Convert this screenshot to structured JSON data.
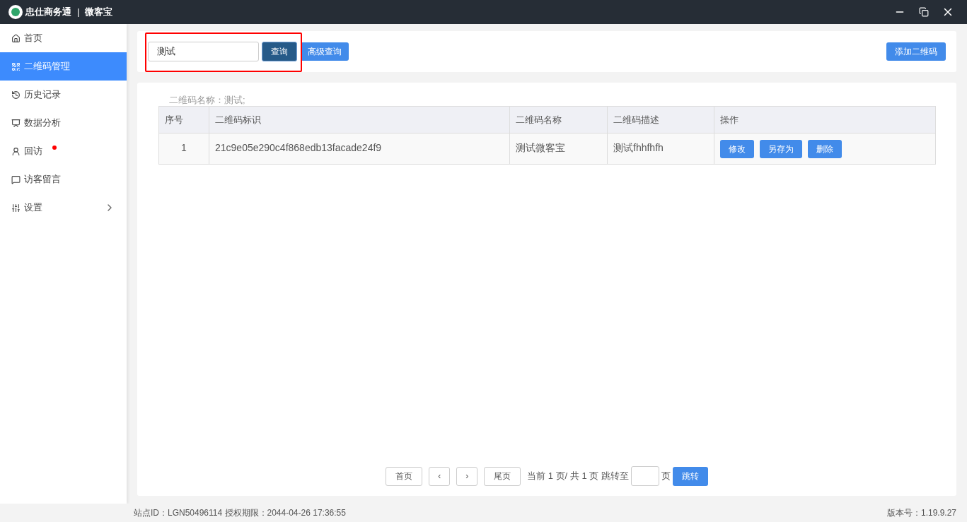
{
  "window": {
    "brand": "忠仕商务通",
    "product": "微客宝",
    "separator": "|"
  },
  "sidebar": {
    "items": [
      {
        "label": "首页",
        "selected": false,
        "badge": false,
        "expandable": false
      },
      {
        "label": "二维码管理",
        "selected": true,
        "badge": false,
        "expandable": false
      },
      {
        "label": "历史记录",
        "selected": false,
        "badge": false,
        "expandable": false
      },
      {
        "label": "数据分析",
        "selected": false,
        "badge": false,
        "expandable": false
      },
      {
        "label": "回访",
        "selected": false,
        "badge": true,
        "expandable": false
      },
      {
        "label": "访客留言",
        "selected": false,
        "badge": false,
        "expandable": false
      },
      {
        "label": "设置",
        "selected": false,
        "badge": false,
        "expandable": true
      }
    ]
  },
  "search": {
    "value": "测试",
    "search_button": "查询",
    "advanced_button": "高级查询",
    "highlighted": true
  },
  "add_button": "添加二维码",
  "filter_summary": "二维码名称：测试;",
  "table": {
    "columns": [
      "序号",
      "二维码标识",
      "二维码名称",
      "二维码描述",
      "操作"
    ],
    "rows": [
      {
        "cells": [
          "1",
          "21c9e05e290c4f868edb13facade24f9",
          "测试微客宝",
          "测试fhhfhfh"
        ],
        "actions": [
          "修改",
          "另存为",
          "删除"
        ]
      }
    ]
  },
  "pagination": {
    "first": "首页",
    "prev": "‹",
    "next": "›",
    "last": "尾页",
    "info": "当前 1 页/ 共 1 页 跳转至",
    "page_unit": "页",
    "go_button": "跳转"
  },
  "status_bar": {
    "left": "站点ID：LGN50496114 授权期限：2044-04-26 17:36:55",
    "right": "版本号：1.19.9.27"
  }
}
